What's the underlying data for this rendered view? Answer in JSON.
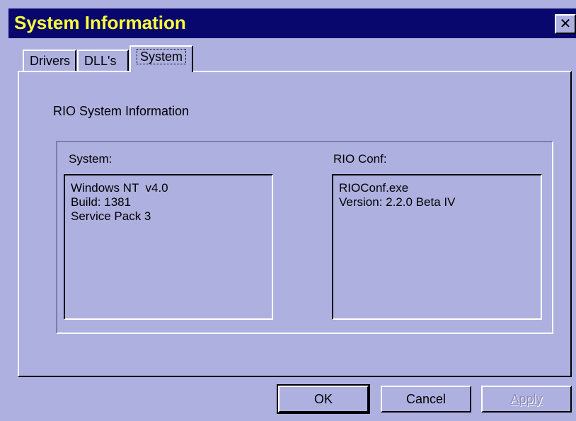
{
  "window": {
    "title": "System Information",
    "close_glyph": "✕"
  },
  "tabs": [
    {
      "label": "Drivers",
      "active": false
    },
    {
      "label": "DLL's",
      "active": false
    },
    {
      "label": "System",
      "active": true
    }
  ],
  "content": {
    "heading": "RIO System Information",
    "system": {
      "label": "System:",
      "lines": [
        "Windows NT  v4.0",
        "Build: 1381",
        "Service Pack 3"
      ]
    },
    "rio_conf": {
      "label": "RIO Conf:",
      "lines": [
        "RIOConf.exe",
        "Version: 2.2.0 Beta IV"
      ]
    }
  },
  "buttons": {
    "ok": "OK",
    "cancel": "Cancel",
    "apply": "Apply"
  },
  "colors": {
    "background": "#aeb0e0",
    "titlebar": "#07076e",
    "title_text": "#ffff3a"
  },
  "icons": {
    "close": "close-icon"
  }
}
